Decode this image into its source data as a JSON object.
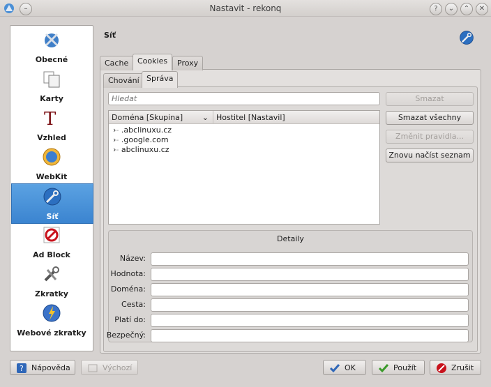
{
  "window": {
    "title": "Nastavit - rekonq"
  },
  "sidebar": {
    "items": [
      {
        "label": "Obecné",
        "icon": "general-icon"
      },
      {
        "label": "Karty",
        "icon": "tabs-icon"
      },
      {
        "label": "Vzhled",
        "icon": "appearance-icon"
      },
      {
        "label": "WebKit",
        "icon": "webkit-icon"
      },
      {
        "label": "Síť",
        "icon": "network-icon",
        "active": true
      },
      {
        "label": "Ad Block",
        "icon": "adblock-icon"
      },
      {
        "label": "Zkratky",
        "icon": "shortcuts-icon"
      },
      {
        "label": "Webové zkratky",
        "icon": "web-shortcuts-icon"
      }
    ]
  },
  "page": {
    "title": "Síť"
  },
  "tabs": [
    {
      "label": "Cache"
    },
    {
      "label": "Cookies"
    },
    {
      "label": "Proxy"
    }
  ],
  "subtabs": [
    {
      "label": "Chování"
    },
    {
      "label": "Správa"
    }
  ],
  "search": {
    "placeholder": "Hledat"
  },
  "tree": {
    "columns": [
      "Doména [Skupina]",
      "Hostitel [Nastavil]"
    ],
    "rows": [
      ".abclinuxu.cz",
      ".google.com",
      "abclinuxu.cz"
    ]
  },
  "actions": {
    "delete": "Smazat",
    "delete_all": "Smazat všechny",
    "change_policy": "Změnit pravidla...",
    "reload": "Znovu načíst seznam"
  },
  "details": {
    "title": "Detaily",
    "fields": [
      "Název:",
      "Hodnota:",
      "Doména:",
      "Cesta:",
      "Platí do:",
      "Bezpečný:"
    ]
  },
  "footer": {
    "help": "Nápověda",
    "defaults": "Výchozí",
    "ok": "OK",
    "apply": "Použít",
    "cancel": "Zrušit"
  },
  "colors": {
    "selection": "#3b84d0",
    "window_bg": "#d6d2d0"
  }
}
